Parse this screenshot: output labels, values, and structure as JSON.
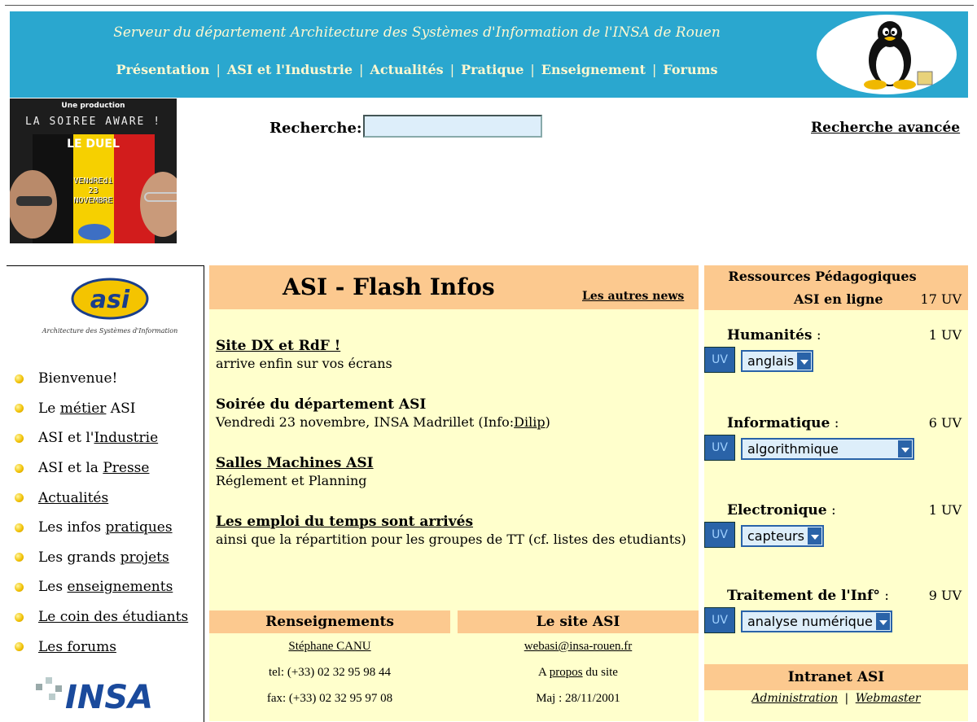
{
  "header": {
    "tagline": "Serveur du département Architecture des Systèmes d'Information de l'INSA de Rouen",
    "nav": [
      "Présentation",
      "ASI et l'Industrie",
      "Actualités",
      "Pratique",
      "Enseignement",
      "Forums"
    ],
    "separator": "|",
    "colors": {
      "banner": "#2aa7cf",
      "banner_text": "#fff8d0"
    }
  },
  "promo": {
    "production": "Une production",
    "title": "LA SOIREE AWARE !",
    "duel": "LE DUEL",
    "date_line1": "VENdREdi",
    "date_line2": "23",
    "date_line3": "NOVEMBRE"
  },
  "search": {
    "label": "Recherche:",
    "value": "",
    "advanced": "Recherche avancée"
  },
  "sidebar": {
    "logo_sub": "Architecture des Systèmes d'Information",
    "items": [
      {
        "pre": "Bienvenue!",
        "link": "",
        "post": ""
      },
      {
        "pre": "Le ",
        "link": "métier",
        "post": " ASI"
      },
      {
        "pre": "ASI et l'",
        "link": "Industrie",
        "post": ""
      },
      {
        "pre": "ASI et la ",
        "link": "Presse",
        "post": ""
      },
      {
        "pre": "",
        "link": "Actualités",
        "post": ""
      },
      {
        "pre": "Les infos ",
        "link": "pratiques",
        "post": ""
      },
      {
        "pre": "Les grands ",
        "link": "projets",
        "post": ""
      },
      {
        "pre": "Les ",
        "link": "enseignements",
        "post": ""
      },
      {
        "pre": "",
        "link": "Le coin des étudiants",
        "post": ""
      },
      {
        "pre": "",
        "link": "Les forums",
        "post": ""
      }
    ]
  },
  "flash": {
    "title": "ASI - Flash Infos",
    "more": "Les autres news",
    "news": [
      {
        "title": "Site DX et RdF !",
        "text": "arrive enfin sur vos écrans"
      },
      {
        "title": "Soirée du département ASI",
        "text": "Vendredi 23 novembre, INSA Madrillet (Info:",
        "link": "Dilip",
        "after": ")"
      },
      {
        "title": "Salles Machines ASI",
        "text": "Réglement et Planning"
      },
      {
        "title": "Les emploi du temps sont arrivés",
        "text": "ainsi que la répartition pour les groupes de TT (cf. listes des etudiants)"
      }
    ]
  },
  "renseignements": {
    "title": "Renseignements",
    "name": "Stéphane CANU",
    "tel": "tel: (+33) 02 32 95 98 44",
    "fax": "fax: (+33) 02 32 95 97 08"
  },
  "site": {
    "title": "Le site ASI",
    "email": "webasi@insa-rouen.fr",
    "about_pre": "A ",
    "about_link": "propos",
    "about_post": " du site",
    "maj": "Maj : 28/11/2001"
  },
  "resources": {
    "title": "Ressources Pédagogiques",
    "online": "ASI en ligne",
    "total": "17 UV",
    "uv_label": "UV",
    "categories": [
      {
        "name": "Humanités",
        "count": "1 UV",
        "selected": "anglais"
      },
      {
        "name": "Informatique",
        "count": "6 UV",
        "selected": "algorithmique"
      },
      {
        "name": "Electronique",
        "count": "1 UV",
        "selected": "capteurs"
      },
      {
        "name": "Traitement de l'Inf°",
        "count": "9 UV",
        "selected": "analyse numérique"
      }
    ],
    "colon": " :"
  },
  "intranet": {
    "title": "Intranet ASI",
    "admin": "Administration",
    "sep": "|",
    "webmaster": "Webmaster"
  }
}
